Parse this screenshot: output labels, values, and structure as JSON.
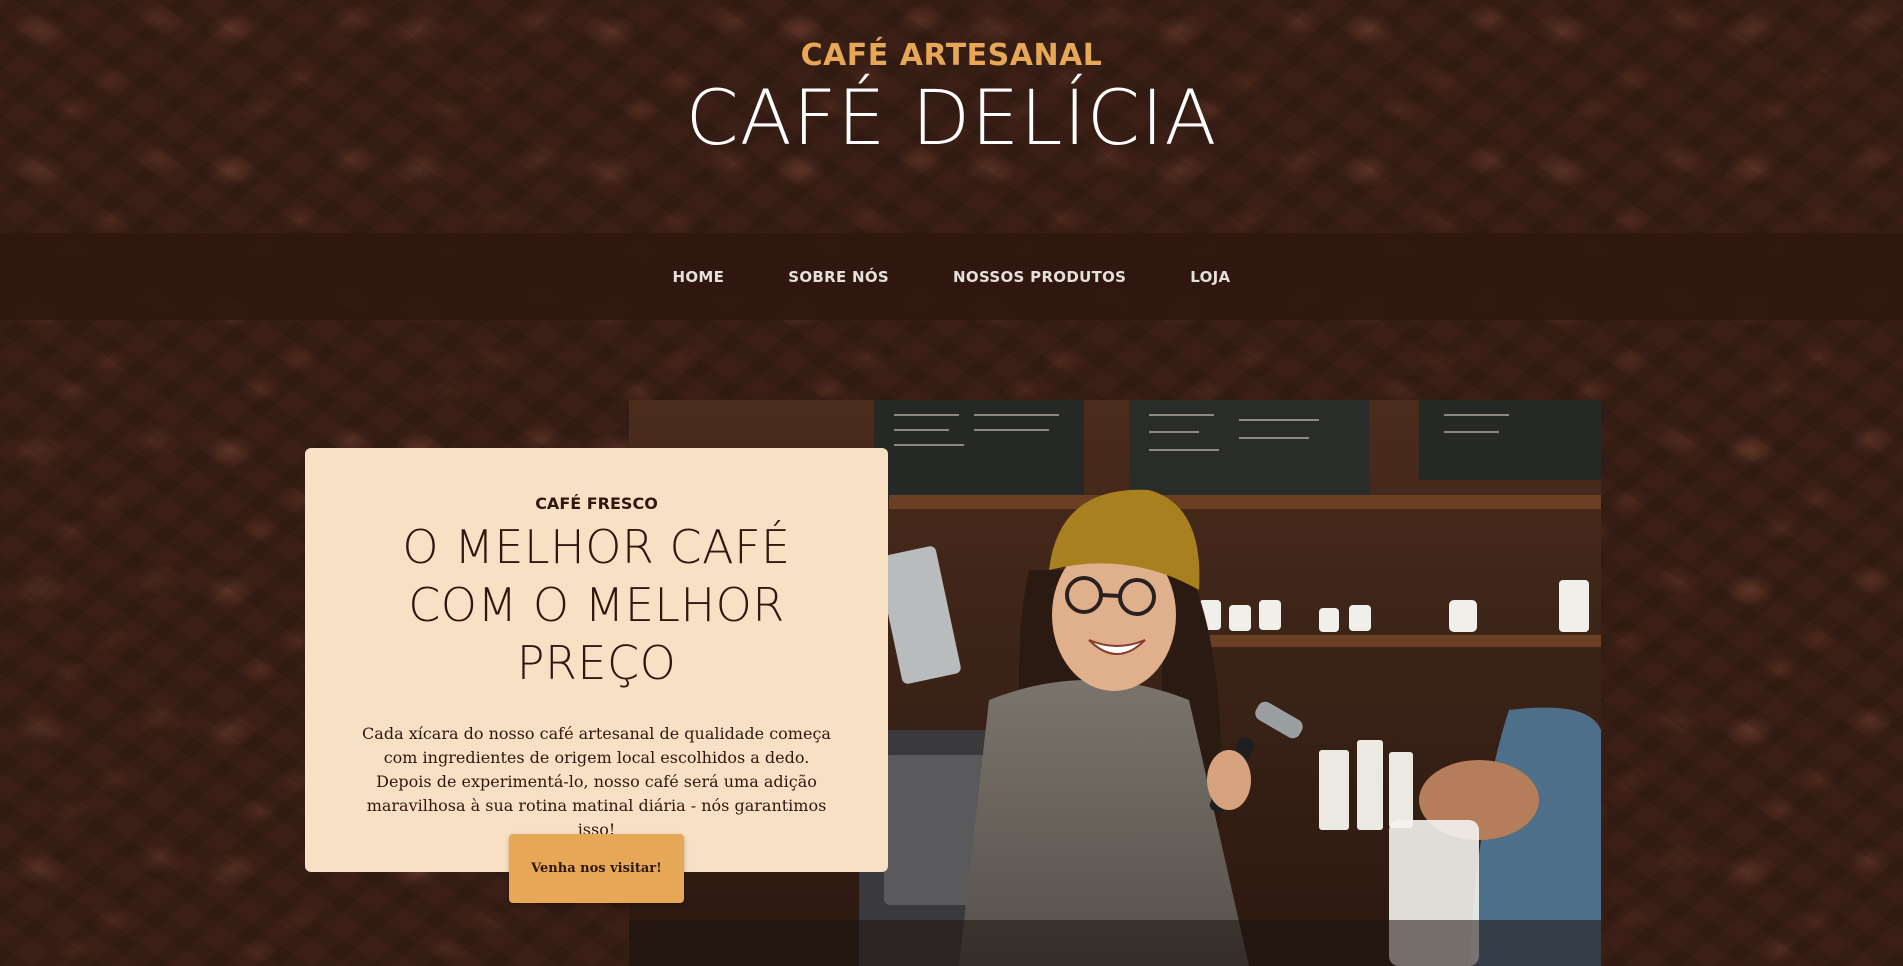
{
  "header": {
    "upper": "CAFÉ ARTESANAL",
    "lower": "CAFÉ DELÍCIA"
  },
  "nav": {
    "items": [
      {
        "label": "HOME"
      },
      {
        "label": "SOBRE NÓS"
      },
      {
        "label": "NOSSOS PRODUTOS"
      },
      {
        "label": "LOJA"
      }
    ]
  },
  "product": {
    "upper": "CAFÉ FRESCO",
    "lower": "O MELHOR CAFÉ COM O MELHOR PREÇO",
    "text": "Cada xícara do nosso café artesanal de qualidade começa com ingredientes de origem local escolhidos a dedo. Depois de experimentá-lo, nosso café será uma adição maravilhosa à sua rotina matinal diária - nós garantimos isso!",
    "button_label": "Venha nos visitar!"
  },
  "colors": {
    "accent": "#e6a756",
    "dark": "#2f170f",
    "card": "#f7e0c3"
  }
}
